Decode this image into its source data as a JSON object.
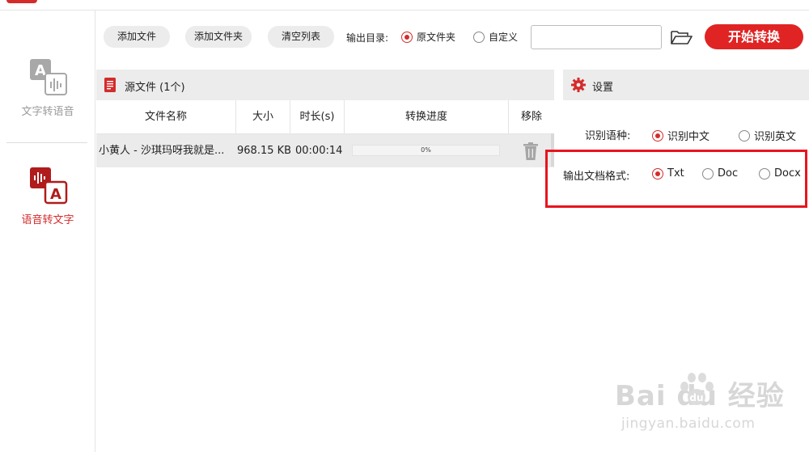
{
  "sidebar": {
    "items": [
      {
        "label": "文字转语音",
        "icon": "text-to-speech-icon",
        "active": false
      },
      {
        "label": "语音转文字",
        "icon": "speech-to-text-icon",
        "active": true
      }
    ]
  },
  "toolbar": {
    "add_file": "添加文件",
    "add_folder": "添加文件夹",
    "clear_list": "清空列表",
    "output_dir_label": "输出目录:",
    "output_options": [
      {
        "label": "原文件夹",
        "checked": true
      },
      {
        "label": "自定义",
        "checked": false
      }
    ],
    "path_value": "",
    "start_label": "开始转换"
  },
  "source_panel": {
    "title": "源文件 (1个)",
    "columns": [
      "文件名称",
      "大小",
      "时长(s)",
      "转换进度",
      "移除"
    ],
    "rows": [
      {
        "name": "小黄人 - 沙琪玛呀我就是...",
        "size": "968.15 KB",
        "duration": "00:00:14",
        "progress": 0,
        "progress_label": "0%"
      }
    ]
  },
  "settings_panel": {
    "title": "设置",
    "language_label": "识别语种:",
    "language_options": [
      {
        "label": "识别中文",
        "checked": true
      },
      {
        "label": "识别英文",
        "checked": false
      }
    ],
    "format_label": "输出文档格式:",
    "format_options": [
      {
        "label": "Txt",
        "checked": true
      },
      {
        "label": "Doc",
        "checked": false
      },
      {
        "label": "Docx",
        "checked": false
      }
    ]
  },
  "watermark": {
    "brand": "Bai  du 经验",
    "url": "jingyan.baidu.com"
  },
  "colors": {
    "accent": "#d42b2b",
    "start_button": "#e02424",
    "highlight_box": "#e8141e",
    "panel_header": "#ececec"
  }
}
